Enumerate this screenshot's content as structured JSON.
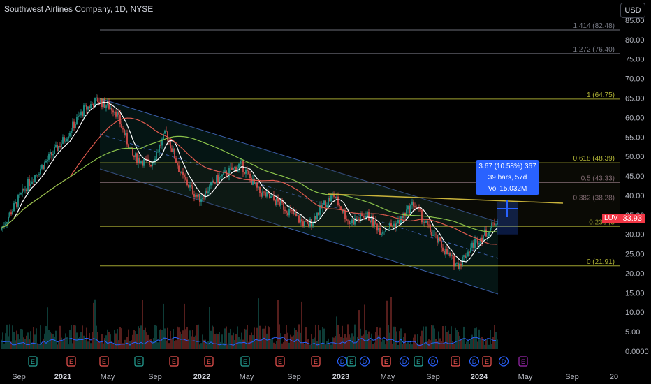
{
  "header": {
    "title": "Southwest Airlines Company, 1D, NYSE",
    "currency_button": "USD"
  },
  "price_scale": {
    "ticks": [
      "85.00",
      "80.00",
      "75.00",
      "70.00",
      "65.00",
      "60.00",
      "55.00",
      "50.00",
      "45.00",
      "40.00",
      "35.00",
      "30.00",
      "25.00",
      "20.00",
      "15.00",
      "10.00",
      "5.00",
      "0.0000"
    ]
  },
  "time_scale": {
    "labels": [
      "Sep",
      "2021",
      "May",
      "Sep",
      "2022",
      "May",
      "Sep",
      "2023",
      "May",
      "Sep",
      "2024",
      "May",
      "Sep",
      "20"
    ]
  },
  "fibonacci": {
    "levels": [
      {
        "label": "1.414 (82.48)",
        "color": "#787b86"
      },
      {
        "label": "1.272 (76.40)",
        "color": "#787b86"
      },
      {
        "label": "1 (64.75)",
        "color": "#b2b536"
      },
      {
        "label": "0.618 (48.39)",
        "color": "#b2b536"
      },
      {
        "label": "0.5 (43.33)",
        "color": "#9c7f8f"
      },
      {
        "label": "0.382 (38.28)",
        "color": "#9c7f8f"
      },
      {
        "label": "0.236 (3",
        "color": "#b2b536"
      },
      {
        "label": "0 (21.91)",
        "color": "#b2b536"
      }
    ]
  },
  "last_price": {
    "ticker": "LUV",
    "value": "33.93",
    "color": "#f23645"
  },
  "measure_tool": {
    "line1": "3.67 (10.58%) 367",
    "line2": "39 bars, 57d",
    "line3": "Vol 15.032M",
    "color": "#2962ff"
  },
  "events": [
    "E",
    "E",
    "E",
    "E",
    "E",
    "E",
    "E",
    "E",
    "E",
    "E",
    "E",
    "D",
    "D",
    "E",
    "D",
    "E",
    "D",
    "E",
    "D",
    "E",
    "D",
    "E"
  ],
  "colors": {
    "up": "#26a69a",
    "down": "#ef5350",
    "sma_fast": "#ffffff",
    "sma_mid": "#e05a4e",
    "sma_slow": "#8bc34a",
    "channel": "#3b5ea8",
    "volume_ma": "#2962ff",
    "trendline": "#c9b33b"
  }
}
